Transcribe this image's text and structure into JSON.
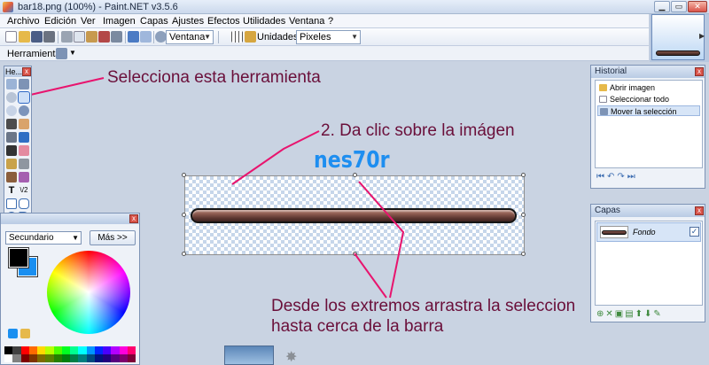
{
  "window": {
    "title": "bar18.png (100%) - Paint.NET v3.5.6",
    "min": "▁",
    "max": "▭",
    "close": "✕"
  },
  "menu": [
    "Archivo",
    "Edición",
    "Ver",
    "Imagen",
    "Capas",
    "Ajustes",
    "Efectos",
    "Utilidades",
    "Ventana",
    "?"
  ],
  "toolbar": {
    "zoom_value": "Ventana",
    "units_label": "Unidades:",
    "units_value": "Pixeles"
  },
  "options": {
    "tool_label": "Herramienta:"
  },
  "tools_window": {
    "title": "He..."
  },
  "colors_window": {
    "mode": "Secundario",
    "more_button": "Más >>",
    "primary_color": "#000000",
    "secondary_color": "#1a8ff0"
  },
  "history": {
    "title": "Historial",
    "items": [
      "Abrir imagen",
      "Seleccionar todo",
      "Mover la selección"
    ],
    "selected_index": 2
  },
  "layers": {
    "title": "Capas",
    "layer_name": "Fondo",
    "visible": true
  },
  "annotations": {
    "select_tool": "Selecciona esta herramienta",
    "step2": "2. Da clic sobre la imágen",
    "watermark": "nes70r",
    "drag_line1": "Desde los extremos arrastra la seleccion",
    "drag_line2": "hasta cerca de la barra"
  },
  "colors": {
    "annotation_arrow": "#e8146e",
    "annotation_text": "#6a0f3a",
    "watermark": "#1e8ef0"
  }
}
